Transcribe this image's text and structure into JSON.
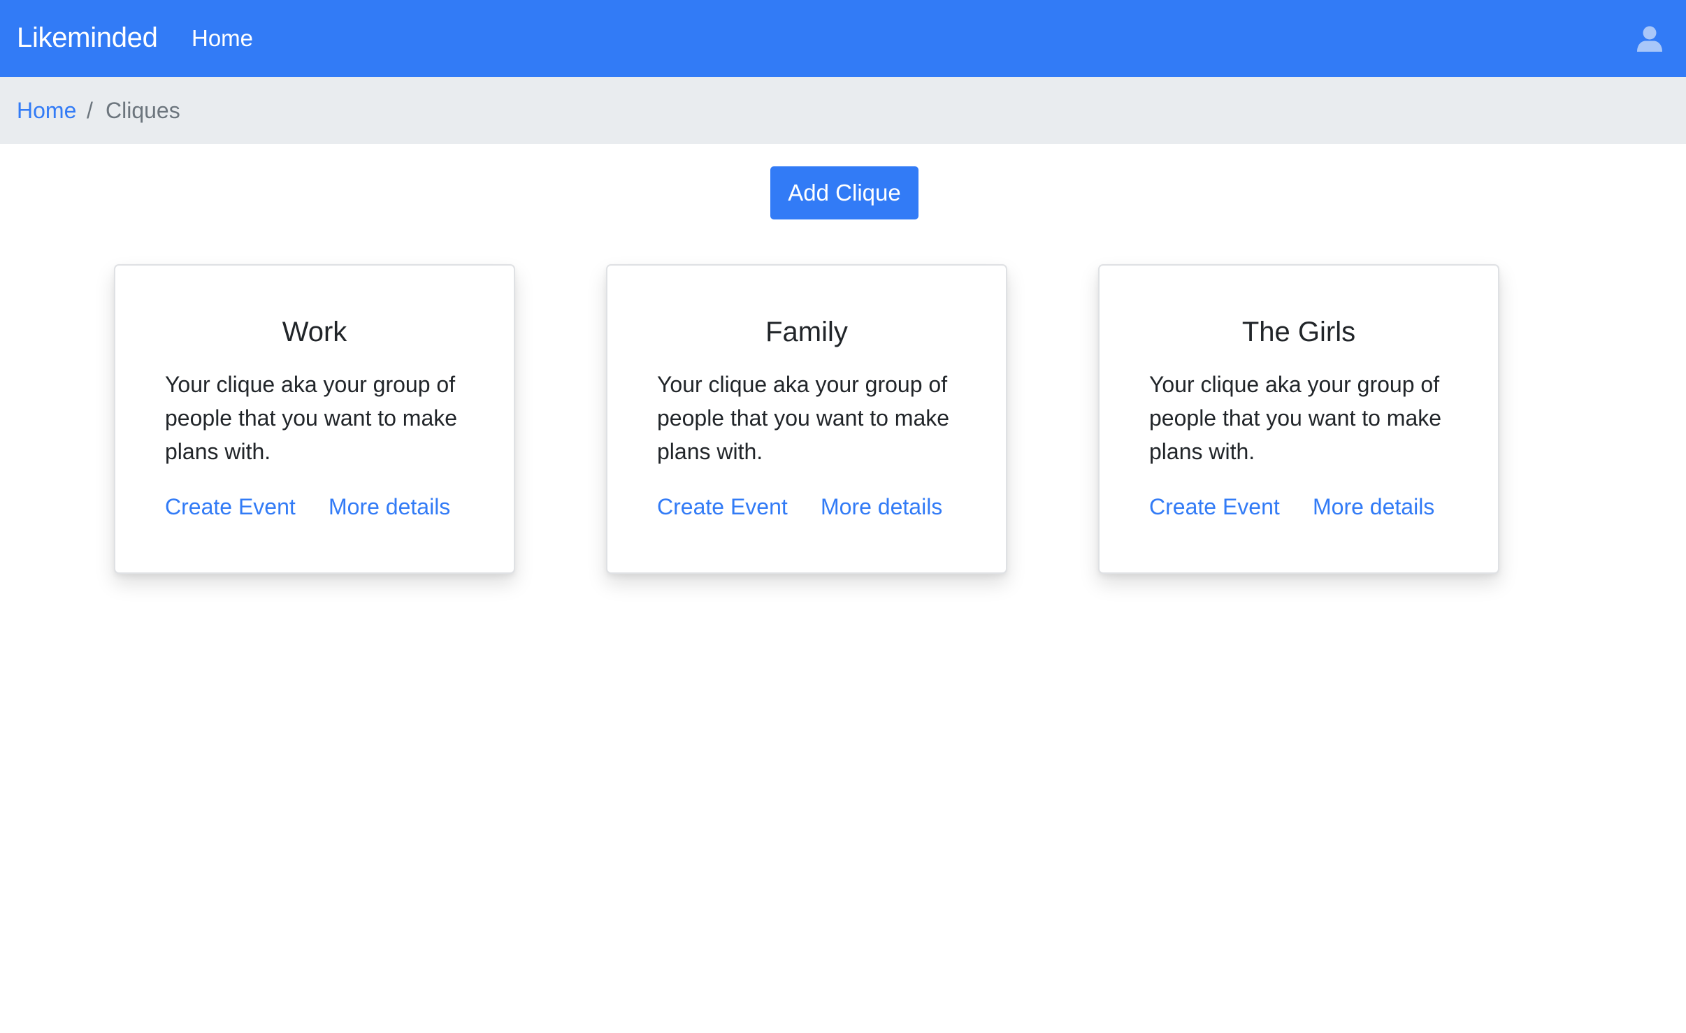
{
  "navbar": {
    "brand": "Likeminded",
    "home_label": "Home",
    "user_icon": "user-icon",
    "background": "#327bf6"
  },
  "breadcrumb": {
    "home_label": "Home",
    "separator": "/",
    "current": "Cliques"
  },
  "actions": {
    "add_clique_label": "Add Clique"
  },
  "cliques": [
    {
      "title": "Work",
      "description": "Your clique aka your group of people that you want to make plans with.",
      "create_event_label": "Create Event",
      "more_details_label": "More details"
    },
    {
      "title": "Family",
      "description": "Your clique aka your group of people that you want to make plans with.",
      "create_event_label": "Create Event",
      "more_details_label": "More details"
    },
    {
      "title": "The Girls",
      "description": "Your clique aka your group of people that you want to make plans with.",
      "create_event_label": "Create Event",
      "more_details_label": "More details"
    }
  ],
  "colors": {
    "accent": "#327bf6",
    "breadcrumb_bg": "#e9ecef",
    "muted_text": "#6c757d"
  }
}
